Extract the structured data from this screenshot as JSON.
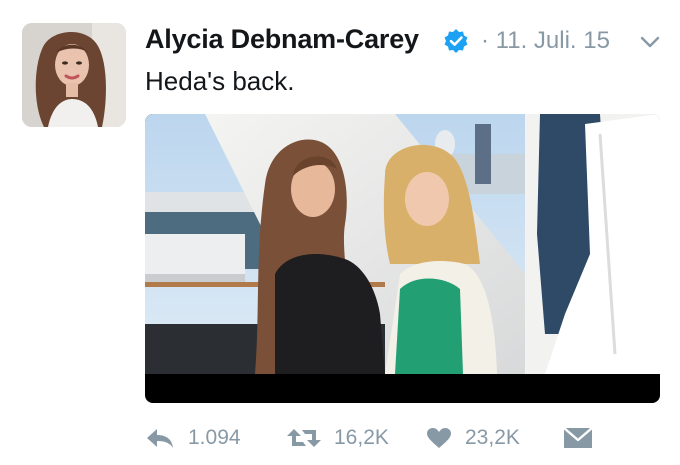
{
  "tweet": {
    "author_name": "Alycia Debnam-Carey",
    "verified": true,
    "separator": "·",
    "date": "11. Juli. 15",
    "text": "Heda's back.",
    "actions": {
      "replies": "1.094",
      "retweets": "16,2K",
      "likes": "23,2K"
    },
    "icons": {
      "avatar": "profile-photo",
      "verified": "verified-badge-icon",
      "menu": "chevron-down-icon",
      "reply": "reply-icon",
      "retweet": "retweet-icon",
      "like": "heart-icon",
      "dm": "envelope-icon"
    },
    "colors": {
      "text": "#14171a",
      "muted": "#8899a6",
      "verified": "#1da1f2"
    }
  }
}
